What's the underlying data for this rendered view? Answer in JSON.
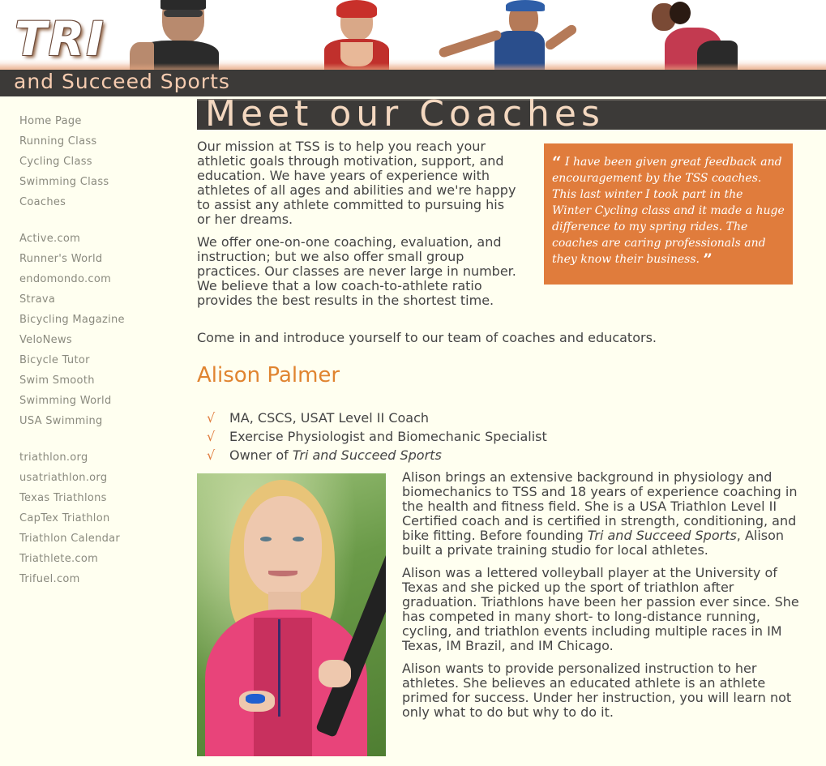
{
  "header": {
    "logo": "TRI",
    "banner": "and Succeed Sports"
  },
  "sidebar": {
    "group1": [
      "Home Page",
      "Running Class",
      "Cycling Class",
      "Swimming Class",
      "Coaches"
    ],
    "group2": [
      "Active.com",
      "Runner's World",
      "endomondo.com",
      "Strava",
      "Bicycling Magazine",
      "VeloNews",
      "Bicycle Tutor",
      "Swim Smooth",
      "Swimming World",
      "USA Swimming"
    ],
    "group3": [
      "triathlon.org",
      "usatriathlon.org",
      "Texas Triathlons",
      "CapTex Triathlon",
      "Triathlon Calendar",
      "Triathlete.com",
      "Trifuel.com"
    ]
  },
  "main": {
    "title": "Meet our Coaches",
    "intro_p1": "Our mission at TSS is to help you reach your athletic goals through motivation, support, and education. We have years of experience with athletes of all ages and abilities and we're happy to assist any athlete committed to pursuing his or her dreams.",
    "intro_p2": "We offer one-on-one coaching, evaluation, and instruction; but we also offer small group practices. Our classes are never large in number. We believe that a low coach-to-athlete ratio provides the best results in the shortest time.",
    "quote_open": "“",
    "quote": "I have been given great feedback and encouragement by the TSS coaches. This last winter I took part in the Winter Cycling class and it made a huge difference to my spring rides. The coaches are caring professionals and they know their business.",
    "quote_close": "”",
    "come_in": "Come in and introduce yourself to our team of coaches and educators.",
    "coach": {
      "name": "Alison Palmer",
      "cred1": "MA, CSCS, USAT Level II Coach",
      "cred2": "Exercise Physiologist and Biomechanic Specialist",
      "cred3_prefix": "Owner of ",
      "cred3_italic": "Tri and Succeed Sports",
      "bio1_a": "Alison brings an extensive background in physiology and biomechanics to TSS and 18 years of experience coaching in the health and fitness field. She is a USA Triathlon Level II Certified coach and is certified in strength, conditioning, and bike fitting. Before founding ",
      "bio1_italic": "Tri and Succeed Sports",
      "bio1_b": ", Alison built a private training studio for local athletes.",
      "bio2": "Alison was a lettered volleyball player at the University of Texas and she picked up the sport of triathlon after graduation. Triathlons have been her passion ever since. She has competed in many short- to long-distance running, cycling, and triathlon events including multiple races in IM Texas, IM Brazil, and IM Chicago.",
      "bio3": "Alison wants to provide personalized instruction to her athletes. She believes an educated athlete is an athlete primed for success. Under her instruction, you will learn not only what to do but why to do it."
    }
  },
  "check_glyph": "√",
  "colors": {
    "accent": "#e07c3c",
    "banner": "#3c3a38",
    "background": "#fffff0",
    "nav_text": "#8a8a7e"
  }
}
